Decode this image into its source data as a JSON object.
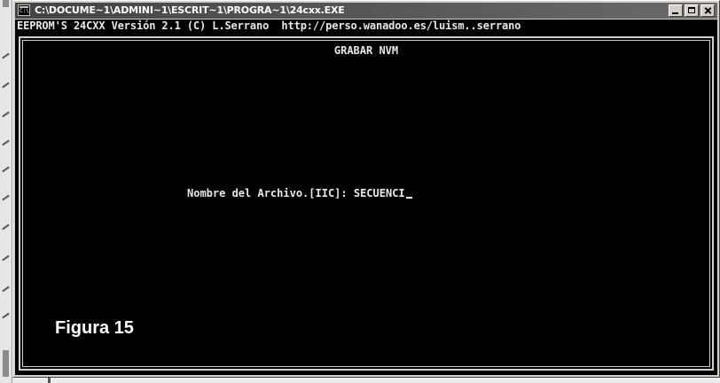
{
  "window": {
    "title": "C:\\DOCUME~1\\ADMINI~1\\ESCRIT~1\\PROGRA~1\\24cxx.EXE",
    "buttons": {
      "minimize": "minimize-icon",
      "maximize": "maximize-icon",
      "close": "close-icon"
    }
  },
  "console": {
    "header": "EEPROM'S 24CXX Versión 2.1 (C) L.Serrano  http://perso.wanadoo.es/luism..serrano",
    "screen_title": "GRABAR NVM",
    "prompt_label": "Nombre del Archivo.[IIC]: ",
    "input_value": "SECUENCI",
    "figure_caption": "Figura 15"
  },
  "colors": {
    "console_background": "#000000",
    "console_text": "#e8e8e8",
    "titlebar": "#4a4a4a"
  }
}
